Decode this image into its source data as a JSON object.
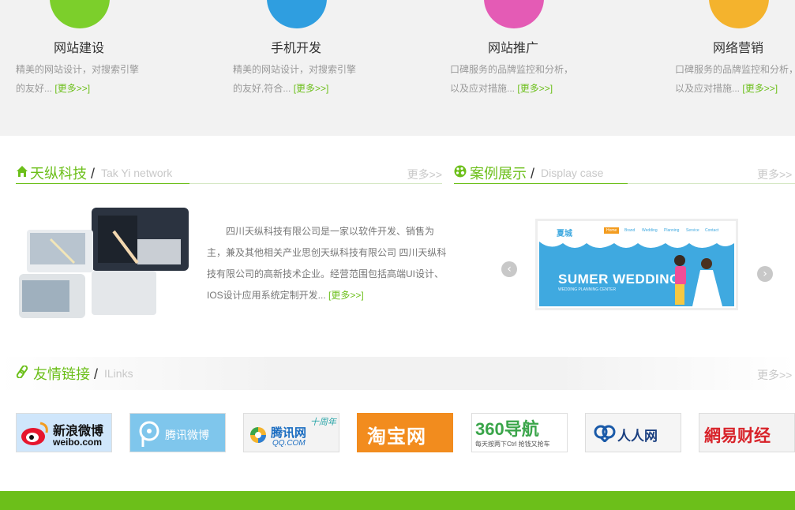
{
  "colors": {
    "accent": "#6cbf1a",
    "muted": "#c8c8c8"
  },
  "services": [
    {
      "title": "网站建设",
      "desc_line1": "精美的网站设计，对搜索引擎",
      "desc_line2": "的友好...",
      "more": "[更多>>]",
      "color": "#7ccf2b",
      "icon": "leaf-icon"
    },
    {
      "title": "手机开发",
      "desc_line1": "精美的网站设计，对搜索引擎",
      "desc_line2": "的友好,符合...",
      "more": "[更多>>]",
      "color": "#2f9ee0",
      "icon": "phone-icon"
    },
    {
      "title": "网站推广",
      "desc_line1": "口碑服务的品牌监控和分析，",
      "desc_line2": "以及应对措施...",
      "more": "[更多>>]",
      "color": "#e45bb5",
      "icon": "speech-icon"
    },
    {
      "title": "网络营销",
      "desc_line1": "口碑服务的品牌监控和分析，",
      "desc_line2": "以及应对措施...",
      "more": "[更多>>]",
      "color": "#f4b32d",
      "icon": "chat-icon"
    }
  ],
  "about": {
    "title_cn": "天纵科技",
    "separator": "/",
    "title_en": "Tak Yi network",
    "more": "更多>>",
    "paragraph": "四川天纵科技有限公司是一家以软件开发、销售为主，兼及其他相关产业思创天纵科技有限公司 四川天纵科技有限公司的高新技术企业。经营范围包括高端UI设计、IOS设计应用系统定制开发...",
    "read_more": "[更多>>]"
  },
  "cases": {
    "title_cn": "案例展示",
    "separator": "/",
    "title_en": "Display case",
    "more": "更多>>",
    "banner_brand": "夏城",
    "banner_title": "SUMER WEDDING",
    "banner_subtitle": "WEDDING PLANNING CENTER",
    "nav": [
      "Home",
      "Brand",
      "Wedding",
      "Planning",
      "Service",
      "Contact"
    ],
    "prev": "‹",
    "next": "›"
  },
  "links": {
    "title_cn": "友情链接",
    "separator": "/",
    "title_en": "ILinks",
    "more": "更多>>",
    "items": [
      {
        "name": "新浪微博",
        "sub": "weibo.com",
        "icon": "weibo-icon"
      },
      {
        "name": "腾讯微博",
        "sub": "",
        "icon": "tencent-weibo-icon"
      },
      {
        "name": "腾讯网",
        "sub": "QQ.COM",
        "badge": "十周年",
        "icon": "qq-icon"
      },
      {
        "name": "淘宝网",
        "sub": "",
        "icon": "taobao-icon"
      },
      {
        "name": "360导航",
        "sub": "每天按两下Ctrl  抢钱又抢车",
        "icon": "360-icon"
      },
      {
        "name": "人人网",
        "sub": "",
        "icon": "renren-icon"
      },
      {
        "name": "網易财经",
        "sub": "",
        "icon": "netease-icon"
      }
    ]
  }
}
